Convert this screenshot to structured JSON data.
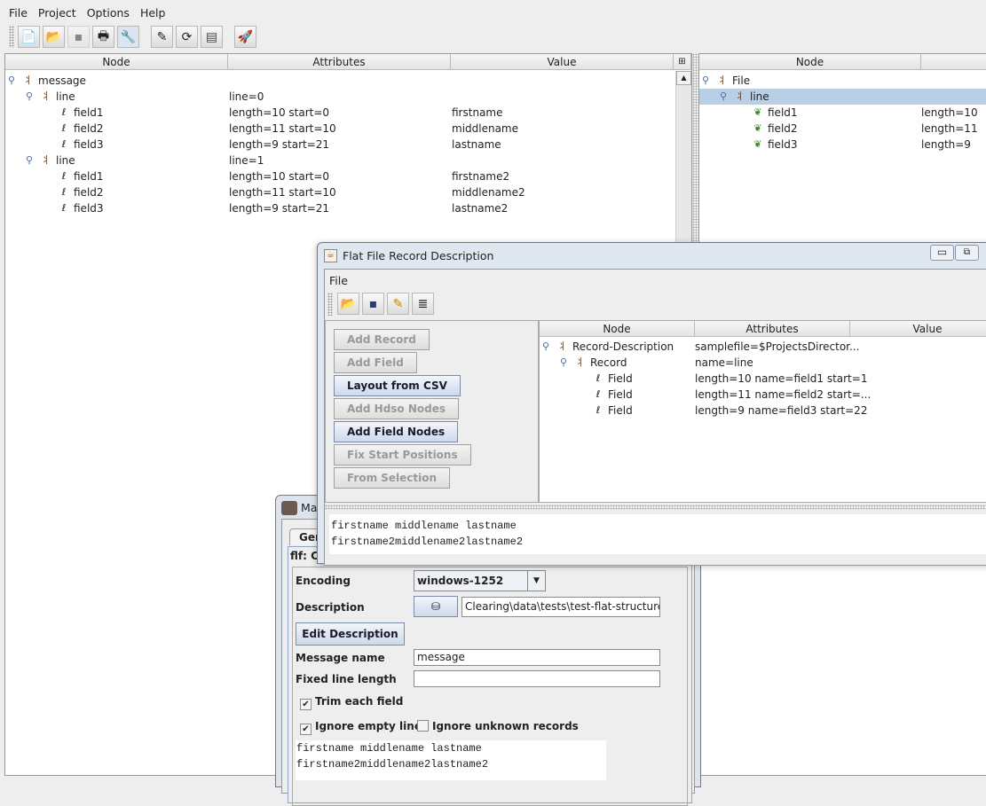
{
  "main": {
    "menu": [
      "File",
      "Project",
      "Options",
      "Help"
    ],
    "toolbar": [
      "new-icon",
      "open-icon",
      "save-icon",
      "print-icon",
      "settings-wrench-icon",
      "edit-icon",
      "refresh-icon",
      "message-icon",
      "run-rocket-icon"
    ],
    "left_table": {
      "columns": [
        "Node",
        "Attributes",
        "Value"
      ],
      "rows": [
        {
          "node": "message",
          "attr": "",
          "value": "",
          "level": 0,
          "type": "branch"
        },
        {
          "node": "line",
          "attr": "line=0",
          "value": "",
          "level": 1,
          "type": "branch"
        },
        {
          "node": "field1",
          "attr": "length=10 start=0",
          "value": "firstname",
          "level": 2,
          "type": "leaf"
        },
        {
          "node": "field2",
          "attr": "length=11 start=10",
          "value": "middlename",
          "level": 2,
          "type": "leaf"
        },
        {
          "node": "field3",
          "attr": "length=9 start=21",
          "value": "lastname",
          "level": 2,
          "type": "leaf"
        },
        {
          "node": "line",
          "attr": "line=1",
          "value": "",
          "level": 1,
          "type": "branch"
        },
        {
          "node": "field1",
          "attr": "length=10 start=0",
          "value": "firstname2",
          "level": 2,
          "type": "leaf"
        },
        {
          "node": "field2",
          "attr": "length=11 start=10",
          "value": "middlename2",
          "level": 2,
          "type": "leaf"
        },
        {
          "node": "field3",
          "attr": "length=9 start=21",
          "value": "lastname2",
          "level": 2,
          "type": "leaf"
        }
      ]
    },
    "right_table": {
      "columns": [
        "Node",
        ""
      ],
      "rows": [
        {
          "node": "File",
          "attr": "",
          "level": 0,
          "type": "branch"
        },
        {
          "node": "line",
          "attr": "",
          "level": 1,
          "type": "branch",
          "selected": true
        },
        {
          "node": "field1",
          "attr": "length=10",
          "level": 2,
          "type": "leaf"
        },
        {
          "node": "field2",
          "attr": "length=11",
          "level": 2,
          "type": "leaf"
        },
        {
          "node": "field3",
          "attr": "length=9",
          "level": 2,
          "type": "leaf"
        }
      ]
    }
  },
  "dialog": {
    "title": "Flat File Record Description",
    "menu": [
      "File"
    ],
    "toolbar": [
      "open-icon",
      "save-icon",
      "save-edit-icon",
      "text-align-icon"
    ],
    "buttons": [
      {
        "label": "Add Record",
        "enabled": false
      },
      {
        "label": "Add Field",
        "enabled": false
      },
      {
        "label": "Layout from CSV",
        "enabled": true
      },
      {
        "label": "Add Hdso Nodes",
        "enabled": false
      },
      {
        "label": "Add Field Nodes",
        "enabled": true
      },
      {
        "label": "Fix Start Positions",
        "enabled": false
      },
      {
        "label": "From Selection",
        "enabled": false
      }
    ],
    "table": {
      "columns": [
        "Node",
        "Attributes",
        "Value"
      ],
      "rows": [
        {
          "node": "Record-Description",
          "attr": "samplefile=$ProjectsDirector...",
          "level": 0,
          "type": "branch"
        },
        {
          "node": "Record",
          "attr": "name=line",
          "level": 1,
          "type": "branch"
        },
        {
          "node": "Field",
          "attr": "length=10 name=field1 start=1",
          "level": 2,
          "type": "leaf"
        },
        {
          "node": "Field",
          "attr": "length=11 name=field2 start=...",
          "level": 2,
          "type": "leaf"
        },
        {
          "node": "Field",
          "attr": "length=9 name=field3 start=22",
          "level": 2,
          "type": "leaf"
        }
      ]
    },
    "sample": [
      "firstname middlename lastname",
      "firstname2middlename2lastname2"
    ]
  },
  "back": {
    "title": "Ma",
    "tab": "Gen",
    "path": "flf: C:\\",
    "encoding_label": "Encoding",
    "encoding": "windows-1252",
    "description_label": "Description",
    "description": "Clearing\\data\\tests\\test-flat-structure.xml",
    "edit_description": "Edit Description",
    "message_name_label": "Message name",
    "message_name": "message",
    "fixed_line_label": "Fixed line length",
    "fixed_line": "",
    "trim_label": "Trim each field",
    "trim": true,
    "ignore_empty_label": "Ignore empty lines",
    "ignore_empty": true,
    "ignore_unknown_label": "Ignore unknown records",
    "ignore_unknown": false,
    "sample": [
      "firstname middlename lastname",
      "firstname2middlename2lastname2"
    ]
  }
}
